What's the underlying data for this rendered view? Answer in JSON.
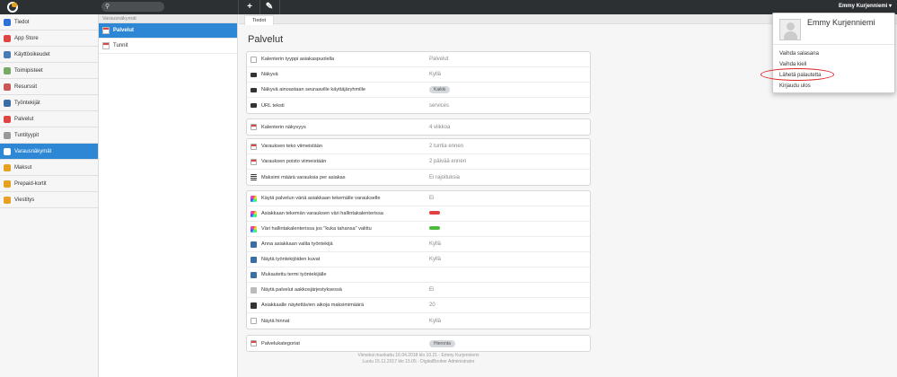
{
  "topbar": {
    "search_icon": "search-icon",
    "add_icon": "+",
    "edit_icon": "pencil-icon",
    "user_name": "Emmy Kurjenniemi ▾"
  },
  "sidebar": {
    "items": [
      {
        "label": "Tiedot",
        "icon": "info-icon",
        "color": "#2d6fd4"
      },
      {
        "label": "App Store",
        "icon": "app-store-icon",
        "color": "#d44"
      },
      {
        "label": "Käyttöoikeudet",
        "icon": "users-icon",
        "color": "#4a7bb5"
      },
      {
        "label": "Toimipisteet",
        "icon": "building-icon",
        "color": "#7a6"
      },
      {
        "label": "Resurssit",
        "icon": "resources-icon",
        "color": "#c55"
      },
      {
        "label": "Työntekijät",
        "icon": "employees-icon",
        "color": "#3a6ea5"
      },
      {
        "label": "Palvelut",
        "icon": "services-icon",
        "color": "#d44"
      },
      {
        "label": "Tuntityypit",
        "icon": "clock-icon",
        "color": "#999"
      },
      {
        "label": "Varausnäkymät",
        "icon": "calendar-view-icon",
        "color": "#fff"
      },
      {
        "label": "Maksut",
        "icon": "payments-icon",
        "color": "#e8a020"
      },
      {
        "label": "Prepaid-kortit",
        "icon": "card-icon",
        "color": "#e8a020"
      },
      {
        "label": "Viestitys",
        "icon": "message-icon",
        "color": "#e8a020"
      }
    ]
  },
  "subpanel": {
    "heading": "Varausnäkymät",
    "items": [
      {
        "label": "Palvelut"
      },
      {
        "label": "Tunnit"
      }
    ]
  },
  "main": {
    "tab": "Tiedot",
    "title": "Palvelut",
    "groups": [
      [
        {
          "icon": "doc",
          "label": "Kalenterin tyyppi asiakaspuolella",
          "value": "Palvelut"
        },
        {
          "icon": "eye",
          "label": "Näkyvä",
          "value": "Kyllä"
        },
        {
          "icon": "eye",
          "label": "Näkyvä ainoastaan seuraaville käyttäjäryhmille",
          "pill": "Kaikki"
        },
        {
          "icon": "eye",
          "label": "URL teksti",
          "value": "services"
        }
      ],
      [
        {
          "icon": "cal",
          "label": "Kalenterin näkyvyys",
          "value": "4 viikkoa"
        }
      ],
      [
        {
          "icon": "cal",
          "label": "Varauksen teko viimeistään",
          "value": "2 tuntia ennen"
        },
        {
          "icon": "cal",
          "label": "Varauksen poisto viimeistään",
          "value": "2 päivää ennen"
        },
        {
          "icon": "list",
          "label": "Maksimi määrä varauksia per asiakas",
          "value": "Ei rajoituksia"
        }
      ],
      [
        {
          "icon": "color",
          "label": "Käytä palvelun väriä asiakkaan tekemälle varaukselle",
          "value": "Ei"
        },
        {
          "icon": "color",
          "label": "Asiakkaan tekemän varauksen väri hallintakalenterissa",
          "swatch": "#e04040"
        },
        {
          "icon": "color",
          "label": "Väri hallintakalenterissa jos \"kuka tahansa\" valittu",
          "swatch": "#4cbb3c"
        },
        {
          "icon": "user",
          "label": "Anna asiakkaan valita työntekijä",
          "value": "Kyllä"
        },
        {
          "icon": "user",
          "label": "Näytä työntekijöiden kuvat",
          "value": "Kyllä"
        },
        {
          "icon": "user",
          "label": "Mukautettu termi työntekijälle",
          "value": ""
        },
        {
          "icon": "abc",
          "label": "Näytä palvelut aakkosjärjestyksessä",
          "value": "Ei"
        },
        {
          "icon": "num",
          "label": "Asiakkaalle näytettävien aikoja maksimimäärä",
          "value": "20"
        },
        {
          "icon": "doc",
          "label": "Näytä hinnat",
          "value": "Kyllä"
        }
      ],
      [
        {
          "icon": "cal",
          "label": "Palvelukategoriat",
          "pill": "Hieronta"
        }
      ]
    ],
    "footer_line1": "Viimeksi muokattu 16.04.2018 klo 10.21 - Emmy Kurjenniemi",
    "footer_line2": "Luotu 15.11.2017 klo 15.05 - DigitalBooker Administrator"
  },
  "dropdown": {
    "name": "Emmy Kurjenniemi",
    "items": [
      {
        "label": "Vaihda salasana"
      },
      {
        "label": "Vaihda kieli"
      },
      {
        "label": "Lähetä palautetta"
      },
      {
        "label": "Kirjaudu ulos"
      }
    ]
  }
}
